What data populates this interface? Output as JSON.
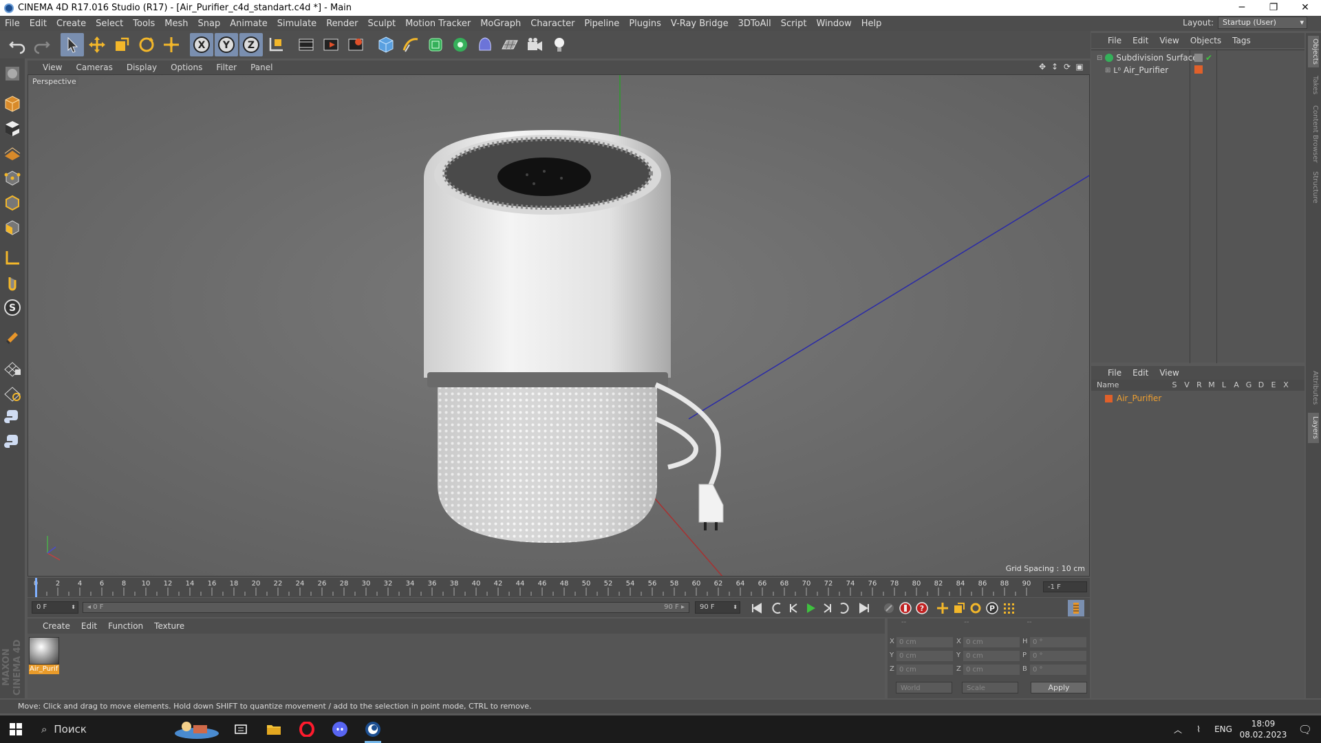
{
  "window": {
    "title": "CINEMA 4D R17.016 Studio (R17) - [Air_Purifier_c4d_standart.c4d *] - Main",
    "controls": [
      "─",
      "❐",
      "✕"
    ]
  },
  "menubar": {
    "items": [
      "File",
      "Edit",
      "Create",
      "Select",
      "Tools",
      "Mesh",
      "Snap",
      "Animate",
      "Simulate",
      "Render",
      "Sculpt",
      "Motion Tracker",
      "MoGraph",
      "Character",
      "Pipeline",
      "Plugins",
      "V-Ray Bridge",
      "3DToAll",
      "Script",
      "Window",
      "Help"
    ],
    "layout_label": "Layout:",
    "layout_value": "Startup (User)"
  },
  "viewport": {
    "menu": [
      "View",
      "Cameras",
      "Display",
      "Options",
      "Filter",
      "Panel"
    ],
    "camera_label": "Perspective",
    "grid_spacing": "Grid Spacing : 10 cm"
  },
  "timeline": {
    "ticks": [
      "0",
      "2",
      "4",
      "6",
      "8",
      "10",
      "12",
      "14",
      "16",
      "18",
      "20",
      "22",
      "24",
      "26",
      "28",
      "30",
      "32",
      "34",
      "36",
      "38",
      "40",
      "42",
      "44",
      "46",
      "48",
      "50",
      "52",
      "54",
      "56",
      "58",
      "60",
      "62",
      "64",
      "66",
      "68",
      "70",
      "72",
      "74",
      "76",
      "78",
      "80",
      "82",
      "84",
      "86",
      "88",
      "90"
    ],
    "end_field": "-1 F"
  },
  "playback": {
    "start_frame": "0 F",
    "slider_start": "◂ 0 F",
    "slider_end": "90 F ▸",
    "end_frame": "90 F"
  },
  "material_manager": {
    "menu": [
      "Create",
      "Edit",
      "Function",
      "Texture"
    ],
    "materials": [
      {
        "label": "Air_Purif"
      }
    ]
  },
  "coordinates": {
    "headers": [
      "--",
      "--",
      "--"
    ],
    "rows": [
      {
        "a1": "X",
        "v1": "0 cm",
        "a2": "X",
        "v2": "0 cm",
        "a3": "H",
        "v3": "0 °"
      },
      {
        "a1": "Y",
        "v1": "0 cm",
        "a2": "Y",
        "v2": "0 cm",
        "a3": "P",
        "v3": "0 °"
      },
      {
        "a1": "Z",
        "v1": "0 cm",
        "a2": "Z",
        "v2": "0 cm",
        "a3": "B",
        "v3": "0 °"
      }
    ],
    "space": "World",
    "mode": "Scale",
    "apply_label": "Apply"
  },
  "object_manager": {
    "menu": [
      "File",
      "Edit",
      "View",
      "Objects",
      "Tags"
    ],
    "objects": [
      {
        "name": "Subdivision Surface"
      },
      {
        "name": "Air_Purifier"
      }
    ]
  },
  "layer_manager": {
    "menu": [
      "File",
      "Edit",
      "View"
    ],
    "name_header": "Name",
    "flags": [
      "S",
      "V",
      "R",
      "M",
      "L",
      "A",
      "G",
      "D",
      "E",
      "X"
    ],
    "layers": [
      {
        "name": "Air_Purifier"
      }
    ]
  },
  "side_tabs": [
    "Objects",
    "Takes",
    "Content Browser",
    "Structure",
    "Attributes",
    "Layers"
  ],
  "status": {
    "text": "Move: Click and drag to move elements. Hold down SHIFT to quantize movement / add to the selection in point mode, CTRL to remove."
  },
  "branding": {
    "logo_text": "MAXON CINEMA 4D"
  },
  "taskbar": {
    "search_label": "Поиск",
    "language": "ENG",
    "time": "18:09",
    "date": "08.02.2023"
  },
  "colors": {
    "viewport_bg": "#6e6e6e",
    "ui_dark": "#4d4d4d",
    "accent_orange": "#e99b2a",
    "active_tool": "#7a8fb0"
  }
}
